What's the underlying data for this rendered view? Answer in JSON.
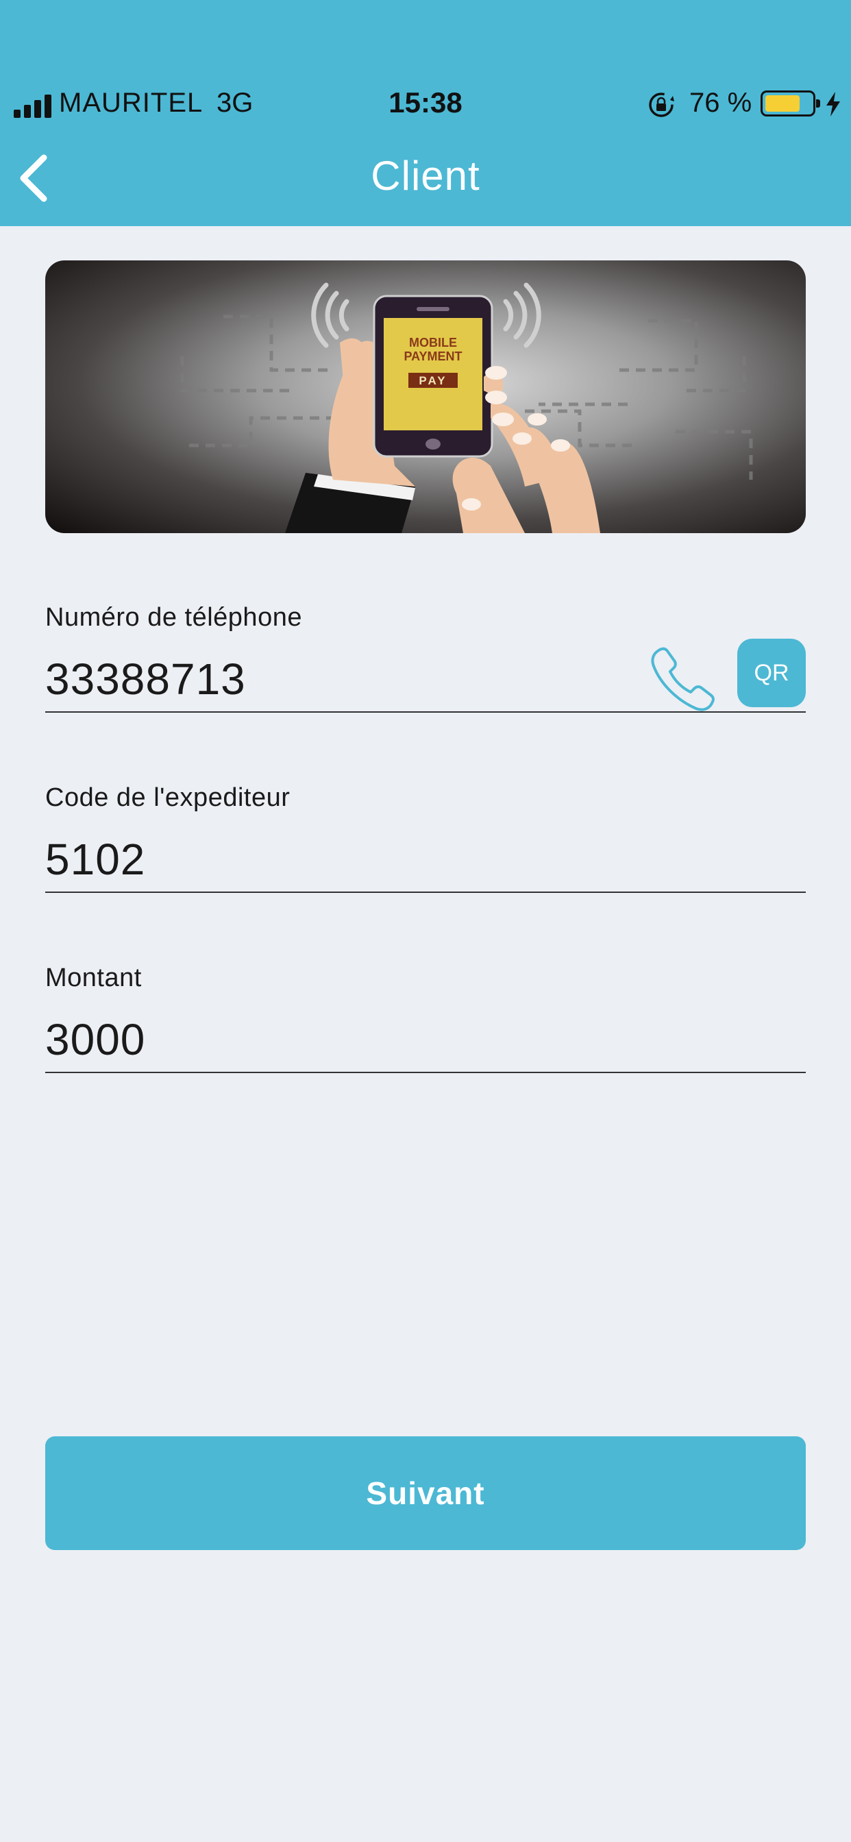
{
  "status_bar": {
    "carrier": "MAURITEL",
    "network": "3G",
    "time": "15:38",
    "battery_percent": "76 %",
    "battery_level": 0.76,
    "icons": [
      "signal-icon",
      "orientation-lock-icon",
      "battery-icon",
      "charging-icon"
    ]
  },
  "header": {
    "title": "Client",
    "back_icon": "chevron-left-icon"
  },
  "banner": {
    "screen_line1": "MOBILE",
    "screen_line2": "PAYMENT",
    "screen_button": "PAY"
  },
  "form": {
    "phone": {
      "label": "Numéro de téléphone",
      "value": "33388713",
      "qr_label": "QR"
    },
    "sender_code": {
      "label": "Code de l'expediteur",
      "value": "5102"
    },
    "amount": {
      "label": "Montant",
      "value": "3000"
    }
  },
  "actions": {
    "next_label": "Suivant"
  },
  "colors": {
    "accent": "#4cb8d4",
    "background": "#eceff4",
    "battery_fill": "#f6cf35"
  }
}
